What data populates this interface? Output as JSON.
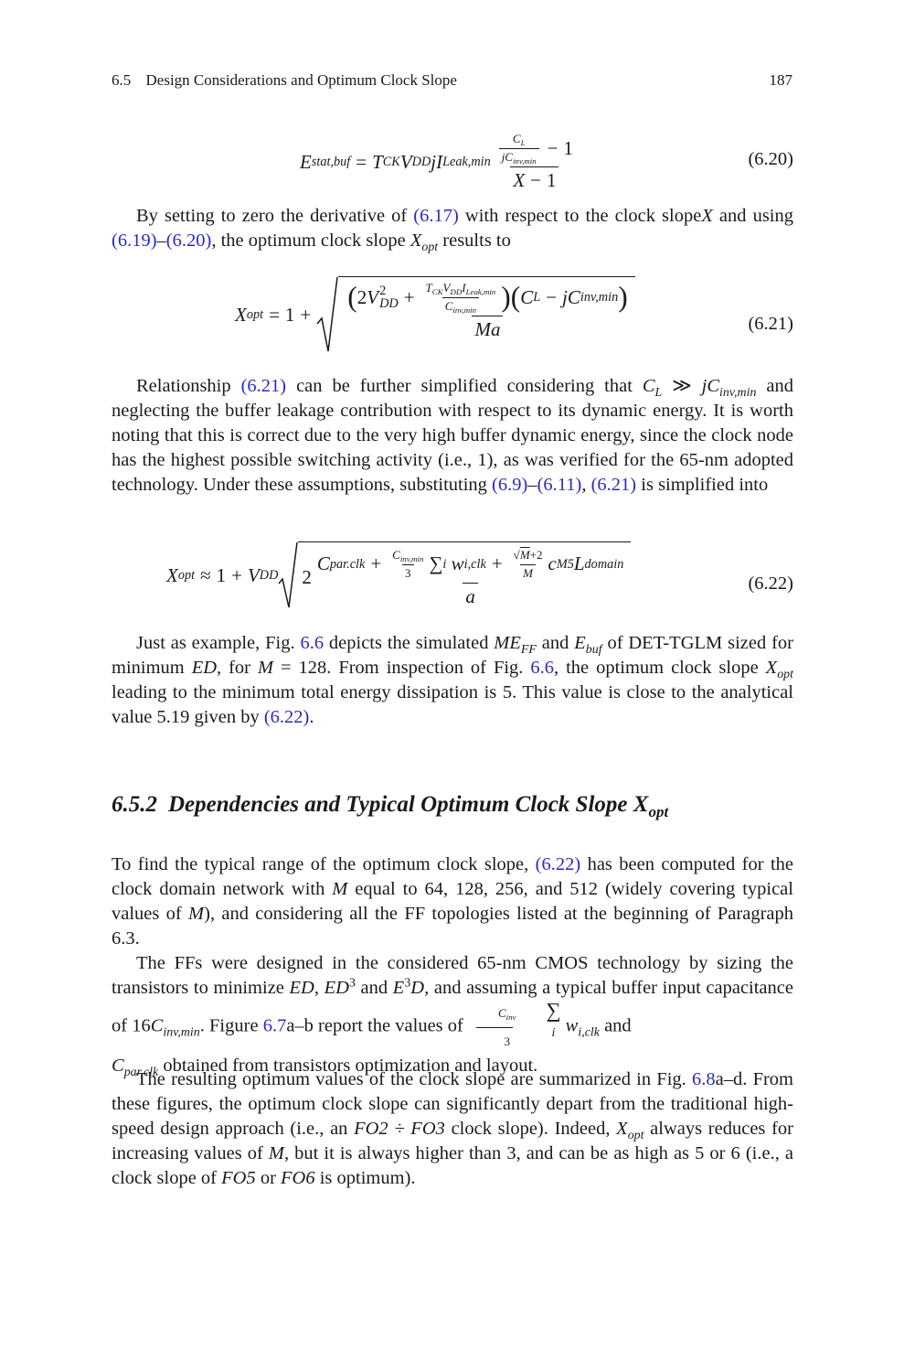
{
  "running_head": {
    "section_number": "6.5",
    "section_title": "Design Considerations and Optimum Clock Slope",
    "page_number": "187"
  },
  "equations": {
    "eq_6_20": {
      "label": "(6.20)",
      "lhs": "E",
      "lhs_sub": "stat,buf",
      "rhs_text": "T_CK V_DD j I_Leak,min (C_L / (j C_inv,min) − 1) / (X − 1)"
    },
    "eq_6_21": {
      "label": "(6.21)",
      "lhs": "X",
      "lhs_sub": "opt",
      "rhs_text": "1 + sqrt( (2V_DD^2 + T_CK V_DD I_Leak,min / C_inv,min)(C_L − jC_inv,min) / (Ma) )"
    },
    "eq_6_22": {
      "label": "(6.22)",
      "lhs": "X",
      "lhs_sub": "opt",
      "rhs_text": "≈ 1 + V_DD sqrt( 2 (C_par.clk + C_inv,min/3 Σ_i w_i,clk + (√M+2)/M c_M5 L_domain) / a )"
    }
  },
  "paragraphs": {
    "p1": {
      "t1": "By setting to zero the derivative of ",
      "ref1": "(6.17)",
      "t2": " with respect to the clock slope",
      "var_x": "X",
      "t3": " and using ",
      "ref2": "(6.19)",
      "dash": "–",
      "ref3": "(6.20)",
      "t4": ", the optimum clock slope ",
      "t5": " results to"
    },
    "p2": {
      "t1": "Relationship ",
      "ref1": "(6.21)",
      "t2": " can be further simplified considering that ",
      "t3": " and neglecting the buffer leakage contribution with respect to its dynamic energy. It is worth noting that this is correct due to the very high buffer dynamic energy, since the clock node has the highest possible switching activity (i.e., 1), as was verified for the 65-nm adopted technology. Under these assumptions, substituting ",
      "ref2": "(6.9)",
      "dash": "–",
      "ref3": "(6.11)",
      "comma": ", ",
      "ref4": "(6.21)",
      "t4": " is simplified into"
    },
    "p3": {
      "t1": "Just as example, Fig. ",
      "ref1": "6.6",
      "t2": " depicts the simulated ",
      "t3": " and ",
      "t4": " of DET-TGLM sized for minimum ",
      "ed": "ED",
      "t5": ", for ",
      "m_eq": "M",
      "t6": " = 128. From inspection of Fig. ",
      "ref2": "6.6",
      "t7": ", the optimum clock slope ",
      "t8": " leading to the minimum total energy dissipation is 5. This value is close to the analytical value 5.19 given by ",
      "ref3": "(6.22)",
      "t9": "."
    },
    "heading": {
      "number": "6.5.2",
      "title": "Dependencies and Typical Optimum Clock Slope"
    },
    "p4": {
      "t1": "To find the typical range of the optimum clock slope, ",
      "ref1": "(6.22)",
      "t2": " has been computed for the clock domain network with ",
      "m": "M",
      "t3": " equal to 64, 128, 256, and 512 (widely covering typical values of ",
      "t4": "), and considering all the FF topologies listed at the beginning of Paragraph 6.3."
    },
    "p5": {
      "t1": "The FFs were designed in the considered 65-nm CMOS technology by sizing the transistors to minimize ",
      "t2": ", ",
      "t3": " and ",
      "t4": ", and assuming a typical buffer input capacitance of 16",
      "t5": ". Figure ",
      "ref1": "6.7",
      "t6": "a–b report the values of ",
      "t7": " and ",
      "t8": " obtained from transistors optimization and layout."
    },
    "p6": {
      "t1": "The resulting optimum values of the clock slope are summarized in Fig. ",
      "ref1": "6.8",
      "t2": "a–d. From these figures, the optimum clock slope can significantly depart from the traditional high-speed design approach (i.e., an ",
      "fo2": "FO2 ÷ FO3",
      "t3": " clock slope). Indeed, ",
      "t4": " always reduces for increasing values of ",
      "t5": ", but it is always higher than 3, and can be as high as 5 or 6 (i.e., a clock slope of ",
      "fo5": "FO5",
      "t6": " or ",
      "fo6": "FO6",
      "t7": " is optimum)."
    }
  },
  "colors": {
    "link": "#2b2bc0",
    "text": "#1a1a1a"
  }
}
